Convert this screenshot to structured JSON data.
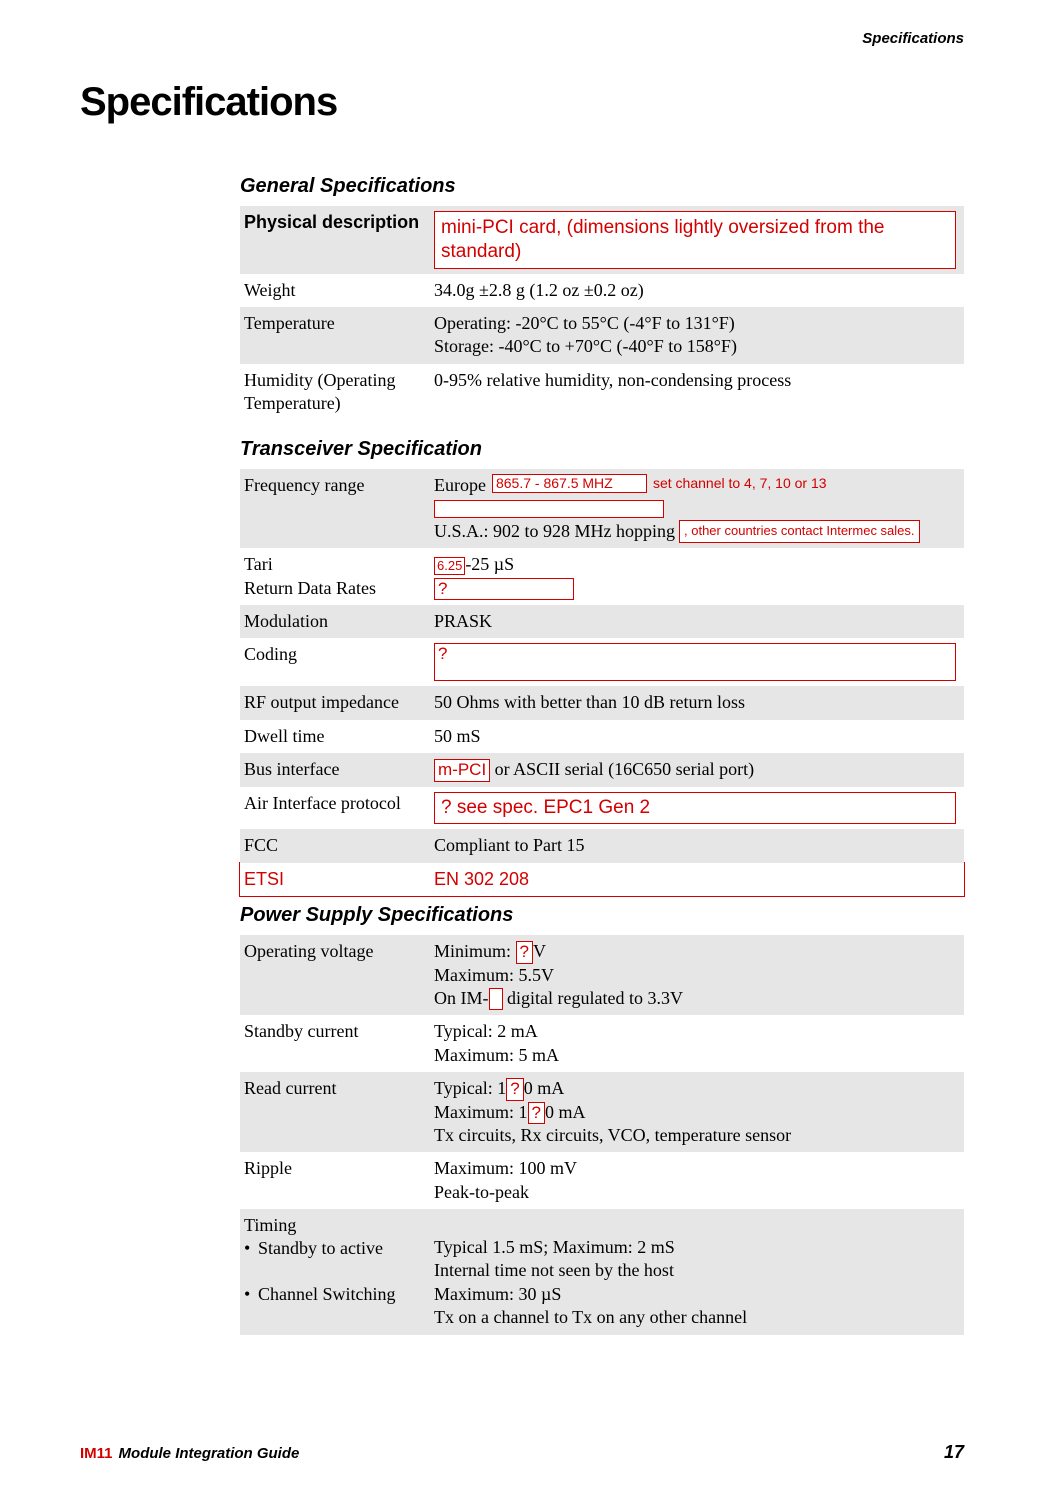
{
  "header": {
    "running": "Specifications"
  },
  "title": "Specifications",
  "sec1": {
    "heading": "General Specifications",
    "rows": {
      "physdesc_label": "Physical description",
      "physdesc_val": "mini-PCI card, (dimensions lightly oversized from the standard)",
      "weight_label": "Weight",
      "weight_val": "34.0g ±2.8 g (1.2 oz ±0.2 oz)",
      "temp_label": "Temperature",
      "temp_val1": "Operating: -20°C to 55°C (-4°F to 131°F)",
      "temp_val2": "Storage: -40°C to +70°C (-40°F to 158°F)",
      "humid_label": "Humidity (Operating Temperature)",
      "humid_val": "0-95% relative humidity, non-condensing process"
    }
  },
  "sec2": {
    "heading": "Transceiver Specification",
    "freq_label": "Frequency range",
    "freq_eu_prefix": "Europe",
    "freq_eu_annot": "865.7 - 867.5  MHZ",
    "freq_eu_note": "set channel to 4, 7, 10 or 13",
    "freq_us": "U.S.A.: 902 to 928 MHz hopping",
    "freq_other": ", other countries contact Intermec sales.",
    "tari_label": "Tari",
    "tari_pre": "6.25",
    "tari_suf": "-25 µS",
    "rdr_label": "Return Data Rates",
    "rdr_val": "?",
    "mod_label": "Modulation",
    "mod_val": "PRASK",
    "coding_label": "Coding",
    "coding_val": "?",
    "rfout_label": "RF output impedance",
    "rfout_val": "50 Ohms with better than 10 dB return loss",
    "dwell_label": "Dwell time",
    "dwell_val": "50 mS",
    "bus_label": "Bus interface",
    "bus_box": "m-PCI",
    "bus_suf": " or ASCII serial (16C650 serial port)",
    "air_label": "Air Interface protocol",
    "air_val": "? see spec. EPC1 Gen 2",
    "fcc_label": "FCC",
    "fcc_val": "Compliant to Part 15",
    "etsi_label": "ETSI",
    "etsi_val": "EN 302 208"
  },
  "sec3": {
    "heading": "Power Supply Specifications",
    "opv_label": "Operating voltage",
    "opv_min_pre": "Minimum: ",
    "opv_min_q": "?",
    "opv_min_suf": "V",
    "opv_max": "Maximum: 5.5V",
    "opv_on_pre": "On IM-",
    "opv_on_suf": " digital regulated to 3.3V",
    "standby_label": "Standby current",
    "standby_typ": "Typical: 2 mA",
    "standby_max": "Maximum: 5 mA",
    "read_label": "Read current",
    "read_typ_pre": "Typical: 1",
    "read_typ_q": "?",
    "read_typ_suf": "0 mA",
    "read_max_pre": "Maximum: 1",
    "read_max_q": "?",
    "read_max_suf": "0 mA",
    "read_note": "Tx circuits, Rx circuits, VCO, temperature sensor",
    "ripple_label": "Ripple",
    "ripple_1": "Maximum: 100 mV",
    "ripple_2": "Peak-to-peak",
    "timing_label": "Timing",
    "timing_a_label": "Standby to active",
    "timing_a_1": "Typical 1.5 mS; Maximum: 2 mS",
    "timing_a_2": "Internal time not seen by the host",
    "timing_b_label": "Channel Switching",
    "timing_b_1": "Maximum: 30 µS",
    "timing_b_2": "Tx on a channel to Tx on any other channel"
  },
  "footer": {
    "prod": "IM11",
    "guide": "Module Integration Guide",
    "page": "17"
  }
}
